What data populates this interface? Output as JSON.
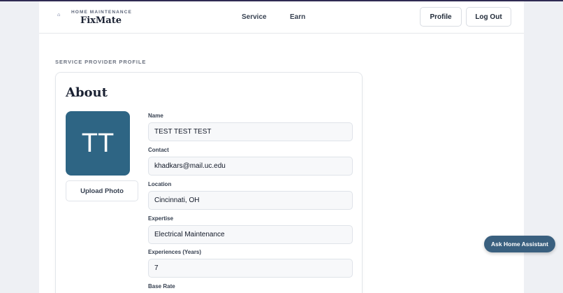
{
  "header": {
    "logo_icon": "house-icon",
    "brand_subtitle": "HOME MAINTENANCE",
    "brand_name": "FixMate",
    "nav": [
      "Service",
      "Earn"
    ],
    "profile_label": "Profile",
    "logout_label": "Log Out"
  },
  "main": {
    "section_label": "SERVICE PROVIDER PROFILE",
    "card_title": "About",
    "avatar_initials": "TT",
    "upload_label": "Upload Photo",
    "fields": [
      {
        "label": "Name",
        "value": "TEST TEST TEST"
      },
      {
        "label": "Contact",
        "value": "khadkars@mail.uc.edu"
      },
      {
        "label": "Location",
        "value": "Cincinnati, OH"
      },
      {
        "label": "Expertise",
        "value": "Electrical Maintenance"
      },
      {
        "label": "Experiences (Years)",
        "value": "7"
      },
      {
        "label": "Base Rate",
        "value": ""
      }
    ]
  },
  "assistant": {
    "label": "Ask Home Assistant"
  },
  "colors": {
    "accent": "#2e6584",
    "assistant": "#3a607f",
    "background": "#eef0f4"
  }
}
